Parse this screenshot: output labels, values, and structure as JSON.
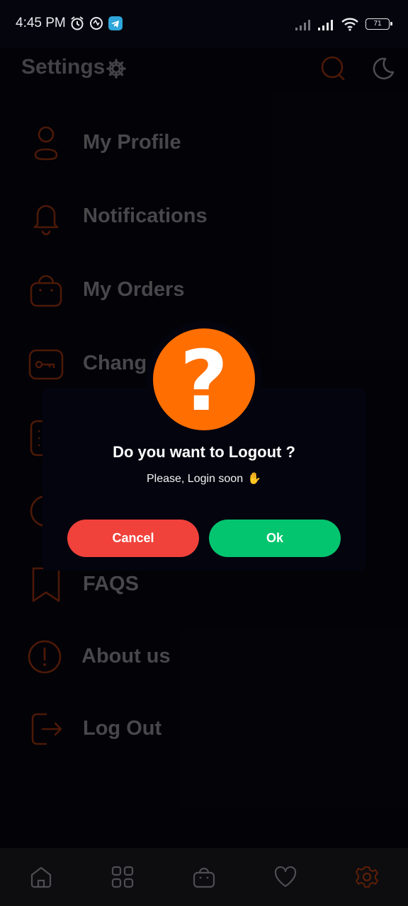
{
  "status_bar": {
    "time": "4:45 PM",
    "battery": "71",
    "icons": [
      "alarm-icon",
      "app-notification-icon",
      "telegram-icon",
      "signal-icon",
      "signal-icon",
      "wifi-icon",
      "battery-icon"
    ]
  },
  "header": {
    "title": "Settings",
    "icons": [
      "gear-icon",
      "search-icon",
      "moon-icon"
    ]
  },
  "menu": {
    "items": [
      {
        "label": "My Profile",
        "icon": "user-icon"
      },
      {
        "label": "Notifications",
        "icon": "bell-icon"
      },
      {
        "label": "My Orders",
        "icon": "bag-icon"
      },
      {
        "label": "Chang",
        "icon": "key-icon"
      },
      {
        "label": "",
        "icon": "document-icon"
      },
      {
        "label": "",
        "icon": "language-icon"
      },
      {
        "label": "FAQS",
        "icon": "bookmark-icon"
      },
      {
        "label": "About us",
        "icon": "info-icon"
      },
      {
        "label": "Log Out",
        "icon": "logout-icon"
      }
    ]
  },
  "dialog": {
    "badge": "?",
    "title": "Do you want to Logout ?",
    "message": "Please, Login soon",
    "message_emoji": "✋",
    "cancel_label": "Cancel",
    "ok_label": "Ok"
  },
  "bottom_nav": {
    "items": [
      "home-icon",
      "categories-icon",
      "cart-icon",
      "favorites-icon",
      "settings-icon"
    ],
    "active": "settings-icon"
  },
  "colors": {
    "accent": "#a9380f",
    "background": "#05050e",
    "badge": "#ff6e00",
    "cancel": "#f0423b",
    "ok": "#04c56f"
  }
}
